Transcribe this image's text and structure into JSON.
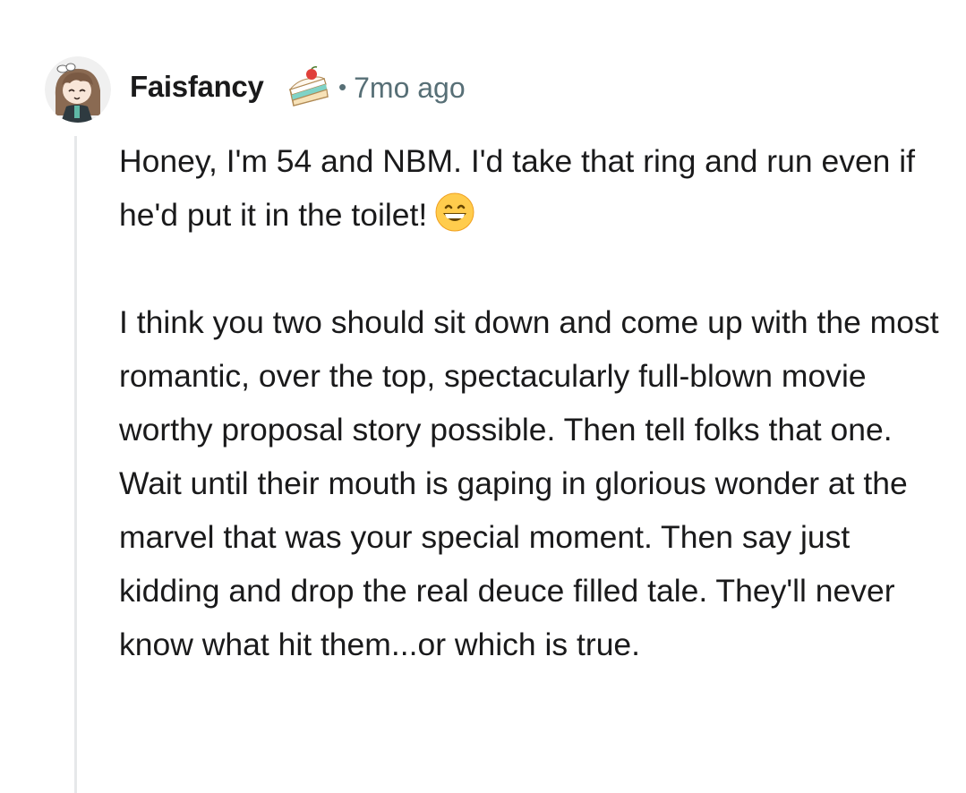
{
  "comment": {
    "author": "Faisfancy",
    "flair_icon": "cake-slice-icon",
    "separator": "•",
    "timestamp": "7mo ago",
    "avatar_icon": "avatar-icon",
    "paragraphs": [
      "Honey, I'm 54 and NBM. I'd take that ring and run even if he'd put it in the toilet!",
      "I think you two should sit down and come up with the most romantic, over the top, spectacularly full-blown movie worthy proposal story possible. Then tell folks that one. Wait until their mouth is gaping in glorious wonder at the marvel that was your special moment. Then say just kidding and drop the real deuce filled tale. They'll never know what hit them...or which is true."
    ],
    "emoji_icon": "grinning-face-emoji-icon"
  },
  "colors": {
    "text": "#1a1a1b",
    "meta": "#576f76",
    "thread_line": "#e6e8ea"
  }
}
